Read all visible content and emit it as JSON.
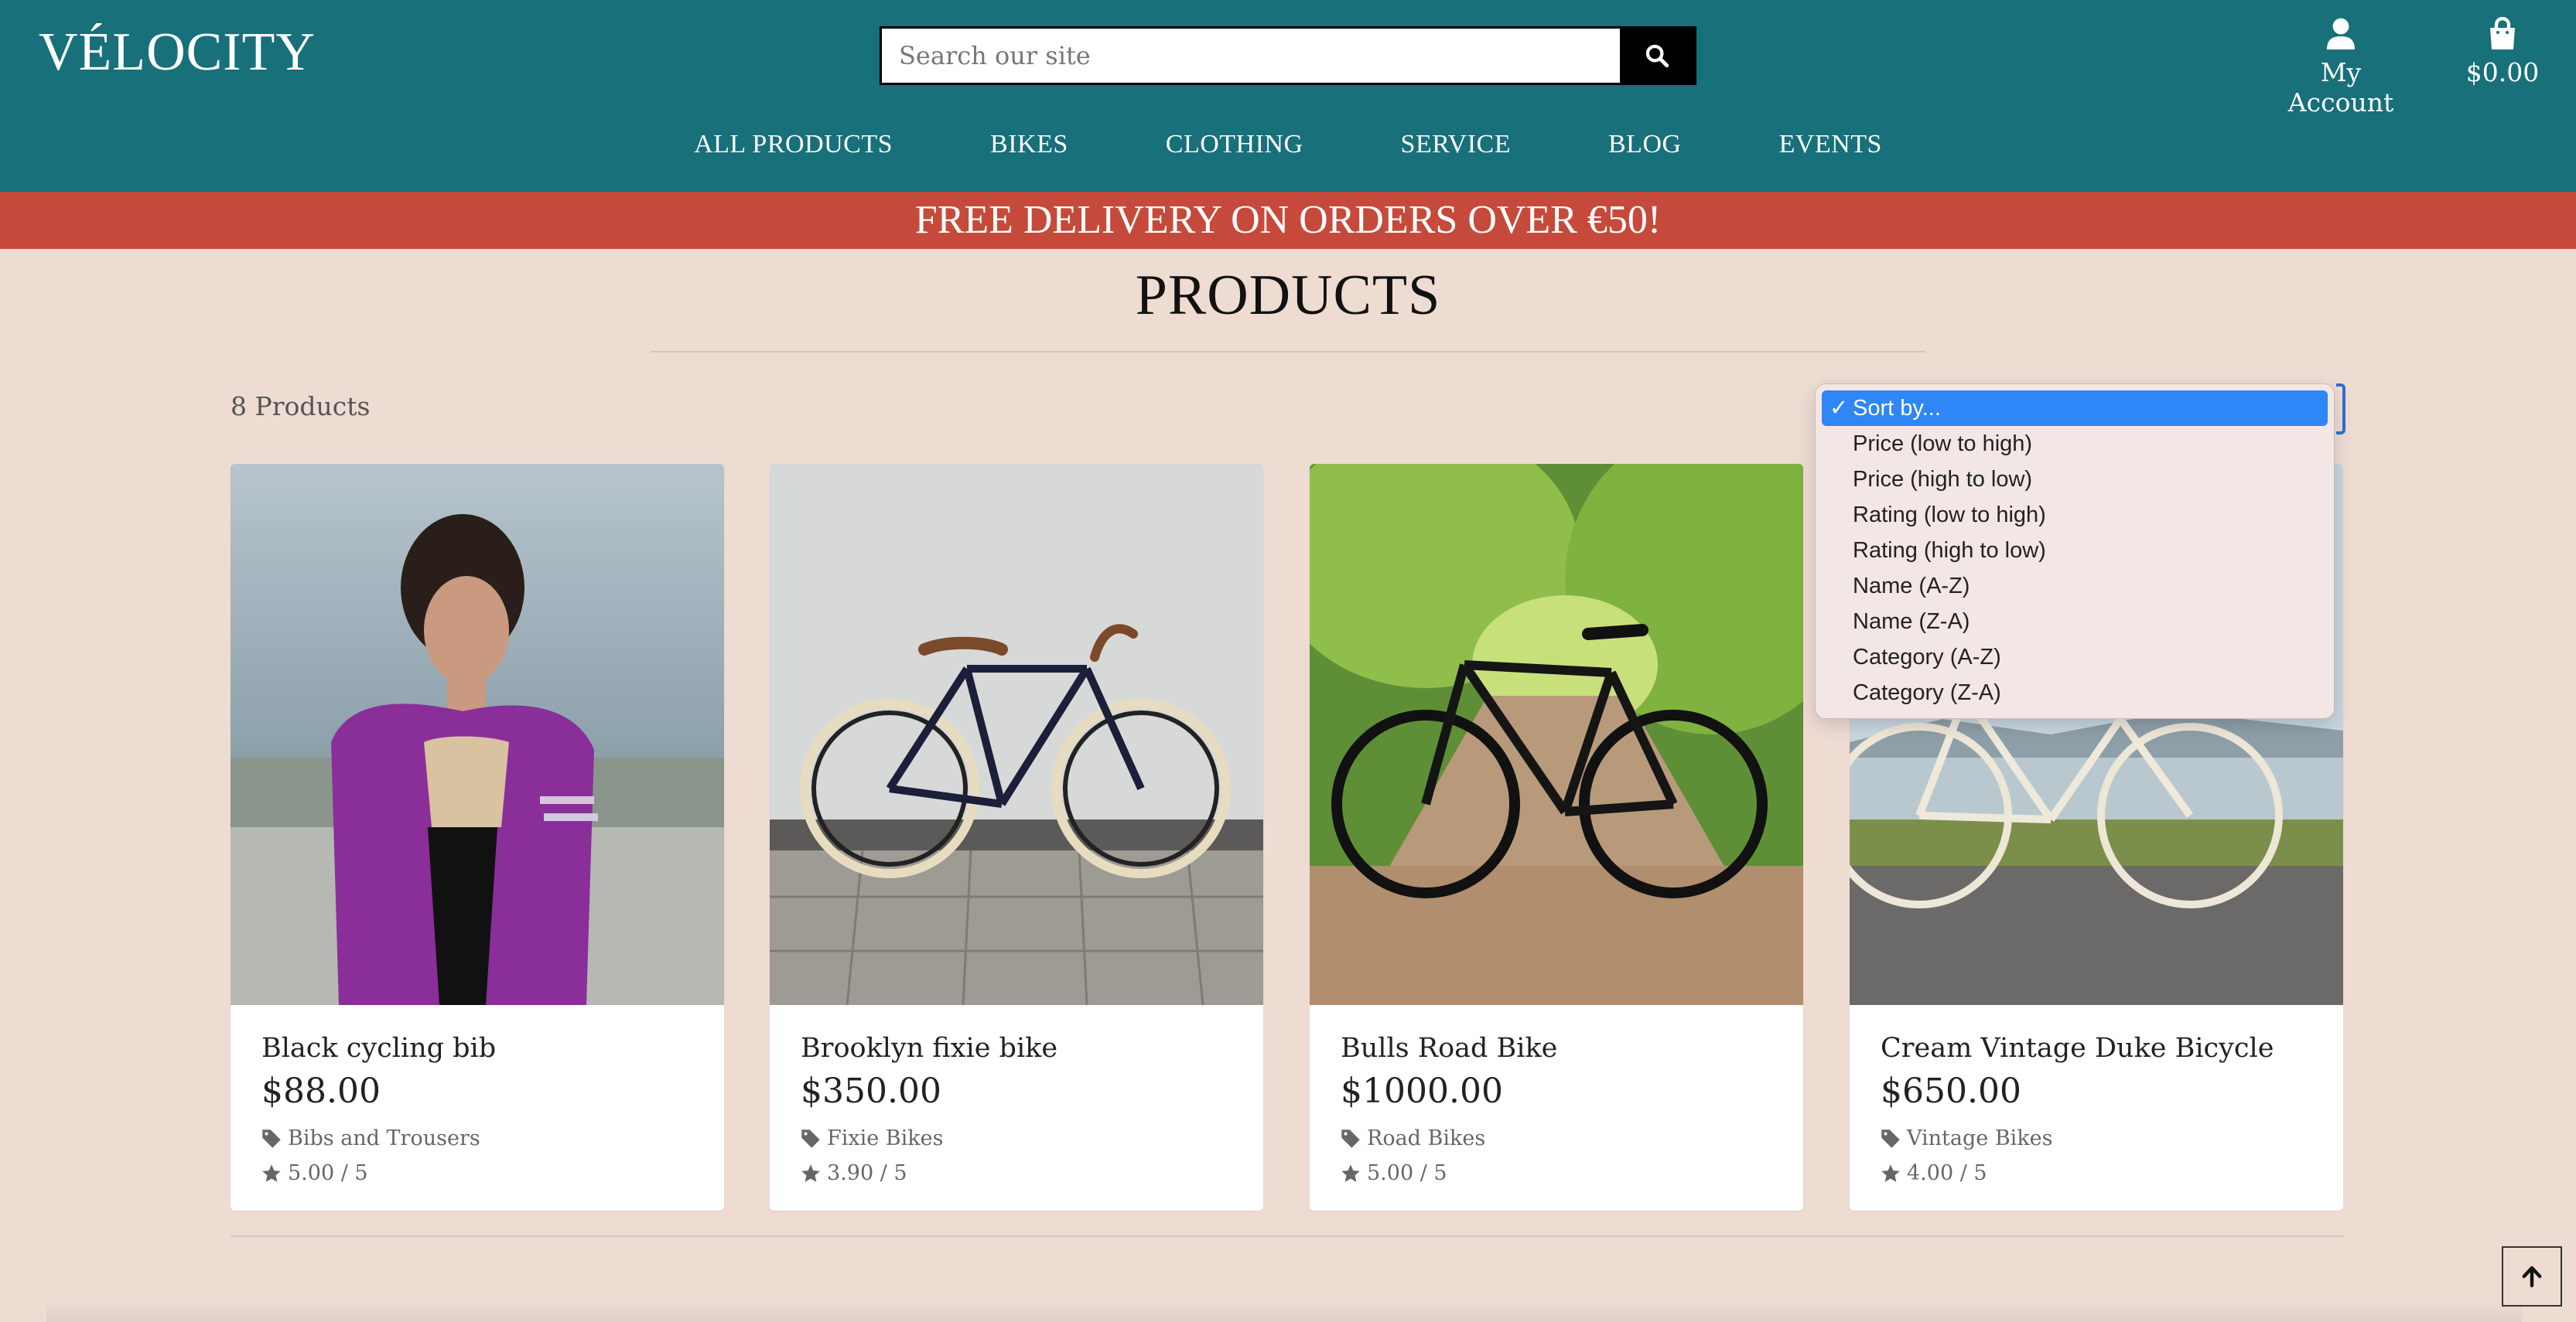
{
  "header": {
    "brand": "VÉLOCITY",
    "search_placeholder": "Search our site",
    "account_label": "My Account",
    "cart_total": "$0.00"
  },
  "nav": [
    {
      "label": "ALL PRODUCTS"
    },
    {
      "label": "BIKES"
    },
    {
      "label": "CLOTHING"
    },
    {
      "label": "SERVICE"
    },
    {
      "label": "BLOG"
    },
    {
      "label": "EVENTS"
    }
  ],
  "banner": "FREE DELIVERY ON ORDERS OVER €50!",
  "page": {
    "title": "PRODUCTS",
    "product_count": "8 Products"
  },
  "sort": {
    "selected": "Sort by...",
    "check": "✓",
    "options": [
      "Sort by...",
      "Price (low to high)",
      "Price (high to low)",
      "Rating (low to high)",
      "Rating (high to low)",
      "Name (A-Z)",
      "Name (Z-A)",
      "Category (A-Z)",
      "Category (Z-A)"
    ]
  },
  "products": [
    {
      "name": "Black cycling bib",
      "price": "$88.00",
      "category": "Bibs and Trousers",
      "rating": "5.00 / 5"
    },
    {
      "name": "Brooklyn fixie bike",
      "price": "$350.00",
      "category": "Fixie Bikes",
      "rating": "3.90 / 5"
    },
    {
      "name": "Bulls Road Bike",
      "price": "$1000.00",
      "category": "Road Bikes",
      "rating": "5.00 / 5"
    },
    {
      "name": "Cream Vintage Duke Bicycle",
      "price": "$650.00",
      "category": "Vintage Bikes",
      "rating": "4.00 / 5"
    }
  ],
  "colors": {
    "header": "#17707a",
    "banner": "#c64a3b",
    "background": "#eedcd3",
    "dropdown_highlight": "#2f86f6"
  },
  "icons": [
    "search-icon",
    "user-icon",
    "shopping-bag-icon",
    "tag-icon",
    "star-icon",
    "arrow-up-icon"
  ]
}
